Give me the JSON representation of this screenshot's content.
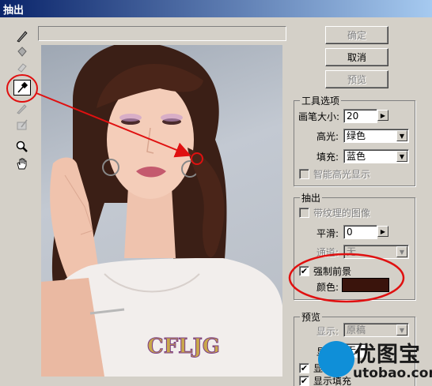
{
  "window": {
    "title": "抽出"
  },
  "tools": [
    "edge-highlighter",
    "fill",
    "eraser",
    "eyedropper",
    "cleanup",
    "edge-touchup",
    "zoom",
    "hand"
  ],
  "buttons": {
    "ok": "确定",
    "cancel": "取消",
    "preview": "预览"
  },
  "tool_options": {
    "title": "工具选项",
    "brush_size_label": "画笔大小:",
    "brush_size_value": "20",
    "highlight_label": "高光:",
    "highlight_value": "绿色",
    "fill_label": "填充:",
    "fill_value": "蓝色",
    "smart_highlight_label": "智能高光显示"
  },
  "extraction": {
    "title": "抽出",
    "textured_label": "带纹理的图像",
    "smooth_label": "平滑:",
    "smooth_value": "0",
    "channel_label": "通道:",
    "channel_value": "无",
    "force_fg_label": "强制前景",
    "force_fg_checked": true,
    "color_label": "颜色:",
    "color_value": "#3a140c"
  },
  "preview": {
    "title": "预览",
    "show_label": "显示:",
    "show_value": "原稿",
    "display_label": "显示:",
    "display_value": "无",
    "check1_label": "显",
    "check2_label": "显示填充"
  },
  "watermark": {
    "canvas_text": "CFLJG",
    "logo_text": "优图宝",
    "logo_url": "utobao.com"
  }
}
